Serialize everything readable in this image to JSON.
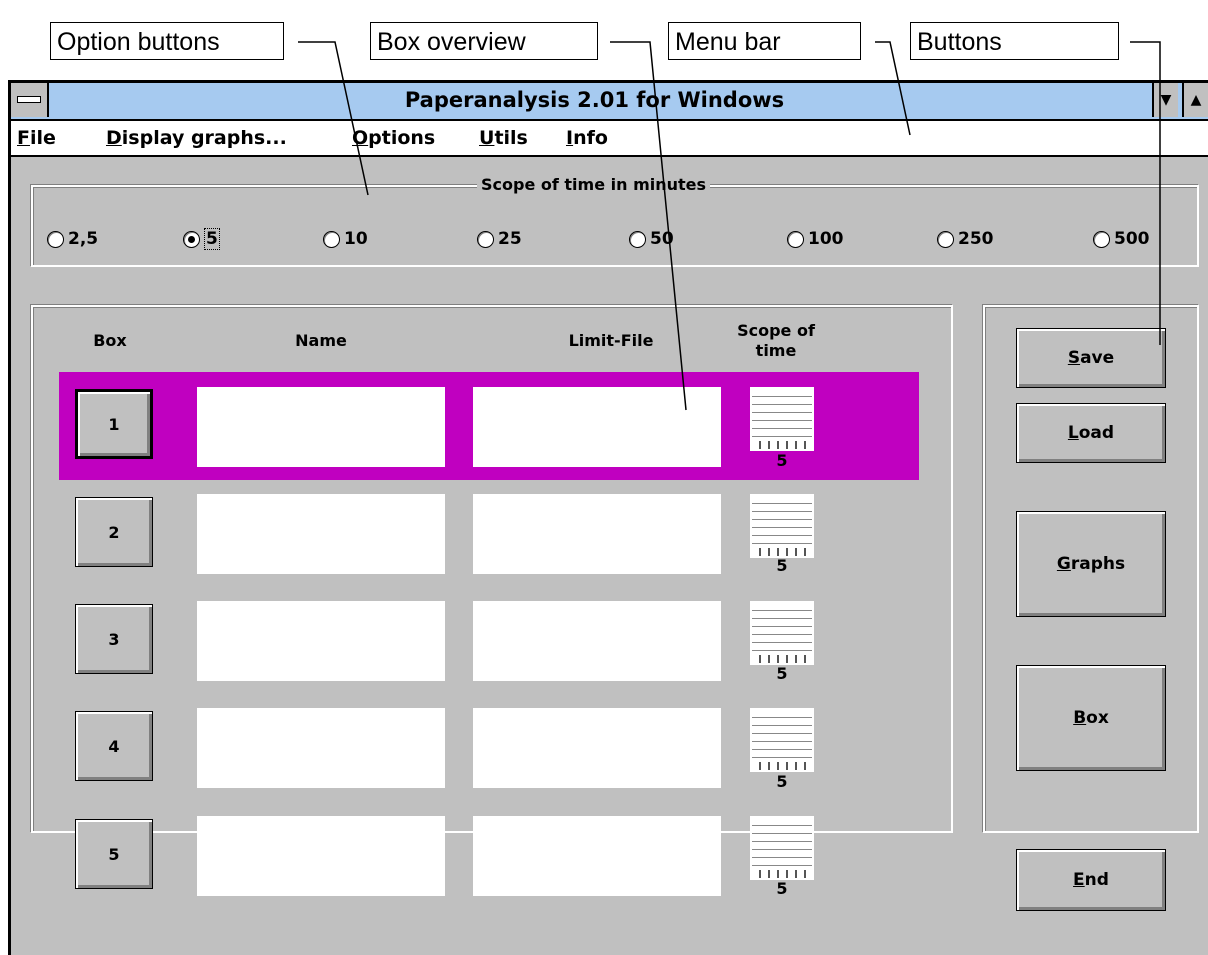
{
  "callouts": [
    "Option buttons",
    "Box overview",
    "Menu bar",
    "Buttons"
  ],
  "window": {
    "title": "Paperanalysis 2.01 for Windows",
    "menu": [
      {
        "accel": "F",
        "rest": "ile"
      },
      {
        "accel": "D",
        "rest": "isplay graphs..."
      },
      {
        "accel": "O",
        "rest": "ptions"
      },
      {
        "accel": "U",
        "rest": "tils"
      },
      {
        "accel": "I",
        "rest": "nfo"
      }
    ]
  },
  "scope_group": {
    "label": "Scope of time in minutes",
    "options": [
      "2,5",
      "5",
      "10",
      "25",
      "50",
      "100",
      "250",
      "500"
    ],
    "selected": "5"
  },
  "boxes": {
    "headers": {
      "box": "Box",
      "name": "Name",
      "limit_file": "Limit-File",
      "scope_line1": "Scope of",
      "scope_line2": "time"
    },
    "rows": [
      {
        "box": "1",
        "name": "",
        "limit_file": "",
        "scope": "5",
        "active": true
      },
      {
        "box": "2",
        "name": "",
        "limit_file": "",
        "scope": "5",
        "active": false
      },
      {
        "box": "3",
        "name": "",
        "limit_file": "",
        "scope": "5",
        "active": false
      },
      {
        "box": "4",
        "name": "",
        "limit_file": "",
        "scope": "5",
        "active": false
      },
      {
        "box": "5",
        "name": "",
        "limit_file": "",
        "scope": "5",
        "active": false
      }
    ],
    "highlight_color": "#c000c0"
  },
  "buttons": [
    {
      "accel": "S",
      "rest": "ave"
    },
    {
      "accel": "L",
      "rest": "oad"
    },
    {
      "accel": "G",
      "rest": "raphs"
    },
    {
      "accel": "B",
      "rest": "ox"
    },
    {
      "accel": "E",
      "rest": "nd"
    }
  ],
  "colors": {
    "titlebar": "#a6caf0",
    "window": "#c0c0c0"
  }
}
